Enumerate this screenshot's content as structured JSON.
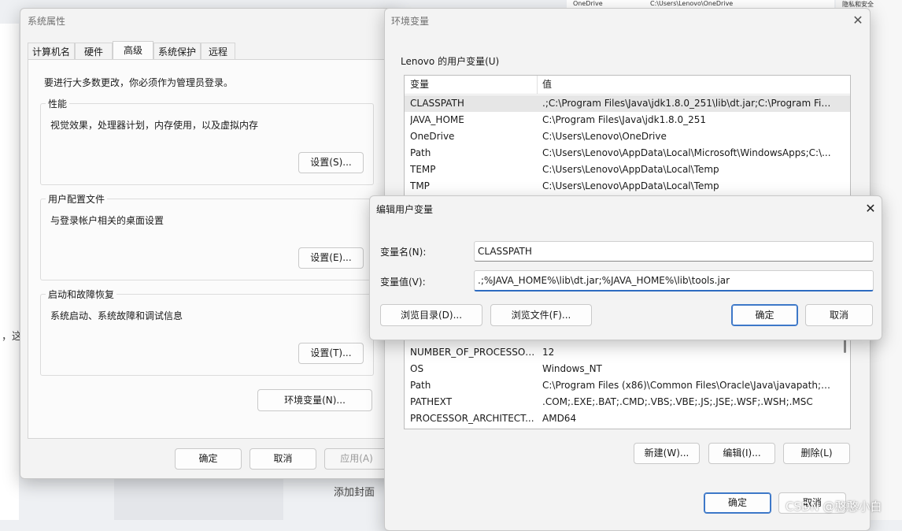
{
  "background": {
    "top_right_col1": "OneDrive",
    "top_right_col2": "C:\\Users\\Lenovo\\OneDrive",
    "top_right_tag": "隐私和安全",
    "left_fragment": "，这",
    "bottom_text": "添加封面",
    "watermark": "CSDN @憨憨小白"
  },
  "sys_props": {
    "title": "系统属性",
    "tabs": [
      "计算机名",
      "硬件",
      "高级",
      "系统保护",
      "远程"
    ],
    "admin_note": "要进行大多数更改，你必须作为管理员登录。",
    "perf_label": "性能",
    "perf_desc": "视觉效果，处理器计划，内存使用，以及虚拟内存",
    "perf_btn": "设置(S)...",
    "profile_label": "用户配置文件",
    "profile_desc": "与登录帐户相关的桌面设置",
    "profile_btn": "设置(E)...",
    "startup_label": "启动和故障恢复",
    "startup_desc": "系统启动、系统故障和调试信息",
    "startup_btn": "设置(T)...",
    "env_btn": "环境变量(N)...",
    "ok": "确定",
    "cancel": "取消",
    "apply": "应用(A)"
  },
  "env_vars": {
    "title": "环境变量",
    "user_section": "Lenovo 的用户变量(U)",
    "col_var": "变量",
    "col_val": "值",
    "user_rows": [
      {
        "name": "CLASSPATH",
        "value": ".;C:\\Program Files\\Java\\jdk1.8.0_251\\lib\\dt.jar;C:\\Program Fil..."
      },
      {
        "name": "JAVA_HOME",
        "value": "C:\\Program Files\\Java\\jdk1.8.0_251"
      },
      {
        "name": "OneDrive",
        "value": "C:\\Users\\Lenovo\\OneDrive"
      },
      {
        "name": "Path",
        "value": "C:\\Users\\Lenovo\\AppData\\Local\\Microsoft\\WindowsApps;C:\\..."
      },
      {
        "name": "TEMP",
        "value": "C:\\Users\\Lenovo\\AppData\\Local\\Temp"
      },
      {
        "name": "TMP",
        "value": "C:\\Users\\Lenovo\\AppData\\Local\\Temp"
      }
    ],
    "sys_rows": [
      {
        "name": "NUMBER_OF_PROCESSORS",
        "value": "12"
      },
      {
        "name": "OS",
        "value": "Windows_NT"
      },
      {
        "name": "Path",
        "value": "C:\\Program Files (x86)\\Common Files\\Oracle\\Java\\javapath;C:..."
      },
      {
        "name": "PATHEXT",
        "value": ".COM;.EXE;.BAT;.CMD;.VBS;.VBE;.JS;.JSE;.WSF;.WSH;.MSC"
      },
      {
        "name": "PROCESSOR_ARCHITECT...",
        "value": "AMD64"
      }
    ],
    "new_btn": "新建(W)...",
    "edit_btn": "编辑(I)...",
    "delete_btn": "删除(L)",
    "ok": "确定",
    "cancel": "取消"
  },
  "edit_dialog": {
    "title": "编辑用户变量",
    "name_label": "变量名(N):",
    "name_value": "CLASSPATH",
    "value_label": "变量值(V):",
    "value_value": ".;%JAVA_HOME%\\lib\\dt.jar;%JAVA_HOME%\\lib\\tools.jar",
    "browse_dir": "浏览目录(D)...",
    "browse_file": "浏览文件(F)...",
    "ok": "确定",
    "cancel": "取消"
  }
}
